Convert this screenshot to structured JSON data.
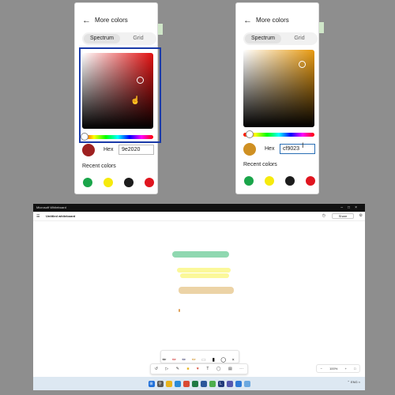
{
  "left_panel": {
    "back_icon": "arrow-left-icon",
    "title": "More colors",
    "tabs": [
      "Spectrum",
      "Grid"
    ],
    "selected_tab": "Spectrum",
    "swatch_color": "#9e2020",
    "hex_label": "Hex",
    "hex_value": "9e2020",
    "recent_label": "Recent colors",
    "recent_colors": [
      "#1aa54a",
      "#f6ea0c",
      "#1c1c1c",
      "#e0151f"
    ]
  },
  "right_panel": {
    "back_icon": "arrow-left-icon",
    "title": "More colors",
    "tabs": [
      "Spectrum",
      "Grid"
    ],
    "selected_tab": "Spectrum",
    "swatch_color": "#cf9023",
    "hex_label": "Hex",
    "hex_value": "cf9023",
    "recent_label": "Recent colors",
    "recent_colors": [
      "#1aa54a",
      "#f6ea0c",
      "#1c1c1c",
      "#e0151f"
    ]
  },
  "whiteboard": {
    "window_title": "Microsoft Whiteboard",
    "doc_title": "Untitled whiteboard",
    "share_label": "Share",
    "zoom": "100%",
    "system": {
      "lang": "ENG"
    },
    "stroke_colors": [
      "#8fd8b0",
      "#fbf89a",
      "#ecd3a6",
      "#e0a25a"
    ]
  }
}
